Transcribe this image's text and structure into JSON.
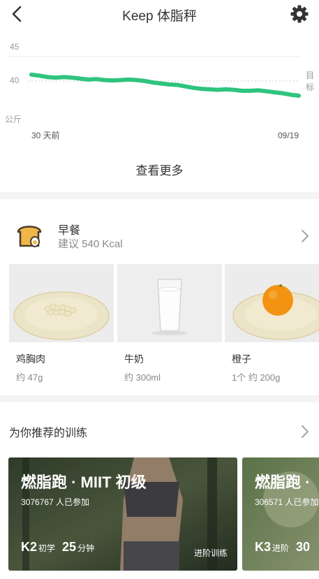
{
  "nav": {
    "title": "Keep 体脂秤"
  },
  "chart_data": {
    "type": "line",
    "y_ticks": [
      "45",
      "40"
    ],
    "y_unit": "公斤",
    "target_label": "目标",
    "target_value": 40,
    "ylim": [
      34,
      46
    ],
    "x_start_label": "30 天前",
    "x_end_label": "09/19",
    "values": [
      41.3,
      41.1,
      40.8,
      40.7,
      40.8,
      40.7,
      40.5,
      40.3,
      40.4,
      40.2,
      40.1,
      40.2,
      40.3,
      40.2,
      40.0,
      39.7,
      39.5,
      39.3,
      39.2,
      38.9,
      38.6,
      38.4,
      38.3,
      38.2,
      38.3,
      38.2,
      38.0,
      38.0,
      38.1,
      37.9,
      37.7,
      37.5,
      37.2,
      37.0
    ],
    "color": "#2fc47e"
  },
  "more_label": "查看更多",
  "meal": {
    "name": "早餐",
    "hint": "建议 540 Kcal",
    "foods": [
      {
        "name": "鸡胸肉",
        "amount": "约 47g"
      },
      {
        "name": "牛奶",
        "amount": "约 300ml"
      },
      {
        "name": "橙子",
        "amount": "1个 约 200g"
      }
    ]
  },
  "recommend": {
    "title": "为你推荐的训练",
    "cards": [
      {
        "title": "燃脂跑 · MIIT 初级",
        "joined": "3076767 人已参加",
        "level": "K2",
        "level_name": "初学",
        "duration": "25",
        "unit": "分钟",
        "tag": "进阶训练"
      },
      {
        "title": "燃脂跑 ·",
        "joined": "306571 人已参加",
        "level": "K3",
        "level_name": "进阶",
        "duration": "30",
        "unit": "",
        "tag": ""
      }
    ]
  }
}
